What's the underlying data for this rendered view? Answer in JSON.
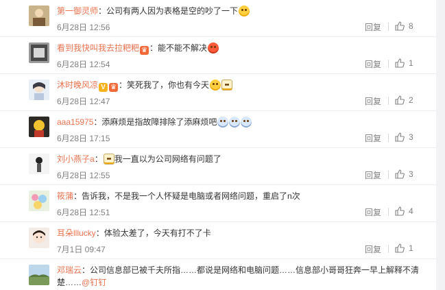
{
  "comments": [
    {
      "name": "第一御灵师",
      "text": "：公司有两人因为表格是空的吵了一下",
      "time": "6月28日 12:56",
      "reply": "回复",
      "likes": "8"
    },
    {
      "name": "看到我快叫我去拉粑粑",
      "text": "：能不能不解决",
      "time": "6月28日 12:54",
      "reply": "回复",
      "likes": "1"
    },
    {
      "name": "沐时晚风凉",
      "text": "：笑死我了，你也有今天",
      "time": "6月28日 12:47",
      "reply": "回复",
      "likes": "2"
    },
    {
      "name": "aaa15975",
      "text": "：添麻烦是指故障排除了添麻烦吧",
      "time": "6月28日 17:15",
      "reply": "回复",
      "likes": "3"
    },
    {
      "name": "刘小燕子a",
      "text": "：",
      "text2": "我一直以为公司网络有问题了",
      "time": "6月28日 12:55",
      "reply": "回复",
      "likes": "3"
    },
    {
      "name": "筱蒲",
      "text": "：告诉我，不是我一个人怀疑是电脑或者网络问题，重启了n次",
      "time": "6月28日 12:51",
      "reply": "回复",
      "likes": "4"
    },
    {
      "name": "耳朵lllucky",
      "text": "：体验太差了，今天有打不了卡",
      "time": "7月1日 09:47",
      "reply": "回复",
      "likes": "1"
    },
    {
      "name": "邓瑞云",
      "text": "：公司信息部已被千夫所指……都说是网络和电脑问题……信息部小哥哥狂奔一早上解释不清楚……",
      "mention": "@钉钉"
    }
  ],
  "colors": {
    "name": "#eb7350",
    "meta": "#808080",
    "mention": "#eb7350"
  }
}
